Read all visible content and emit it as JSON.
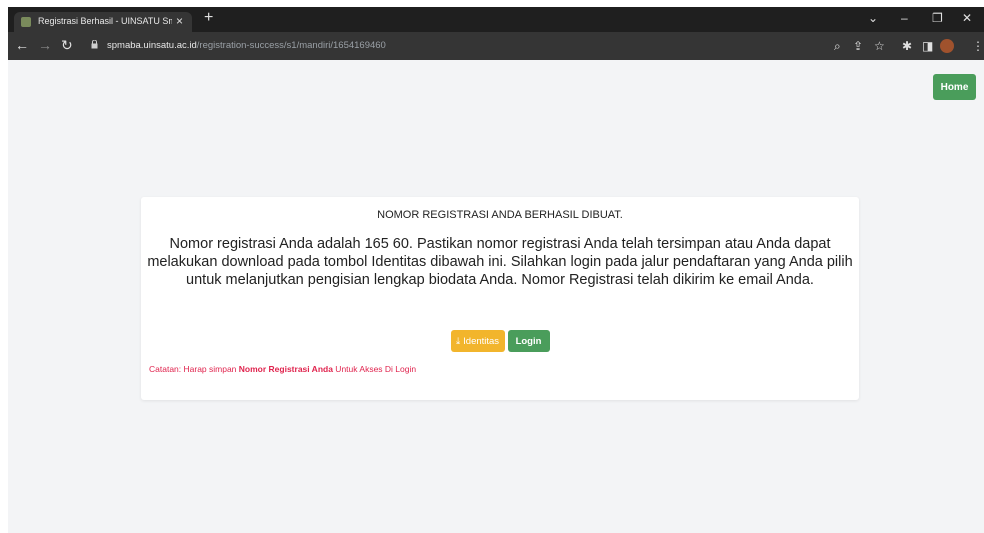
{
  "browser": {
    "tab_title": "Registrasi Berhasil - UINSATU Sm",
    "tab_close": "×",
    "new_tab": "+",
    "url_host": "spmaba.uinsatu.ac.id",
    "url_path": "/registration-success/s1/mandiri/1654169460",
    "icons": [
      "back-arrow",
      "forward-arrow",
      "reload",
      "lock",
      "zoom",
      "share",
      "star",
      "extensions",
      "sidebar",
      "profile",
      "more"
    ]
  },
  "header": {
    "home_label": "Home"
  },
  "card": {
    "title": "NOMOR REGISTRASI ANDA BERHASIL DIBUAT.",
    "message": "Nomor registrasi Anda adalah 165          60. Pastikan nomor registrasi Anda telah tersimpan atau Anda dapat melakukan download pada tombol Identitas dibawah ini. Silahkan login pada jalur pendaftaran yang Anda pilih untuk melanjutkan pengisian lengkap biodata Anda. Nomor Registrasi telah dikirim ke email Anda.",
    "identitas_label": "Identitas",
    "login_label": "Login",
    "note_prefix": "Catatan: Harap simpan ",
    "note_bold": "Nomor Registrasi Anda",
    "note_suffix": " Untuk Akses Di Login"
  },
  "colors": {
    "green": "#4a9d5b",
    "yellow": "#f2b52c",
    "note_red": "#e0244e"
  }
}
